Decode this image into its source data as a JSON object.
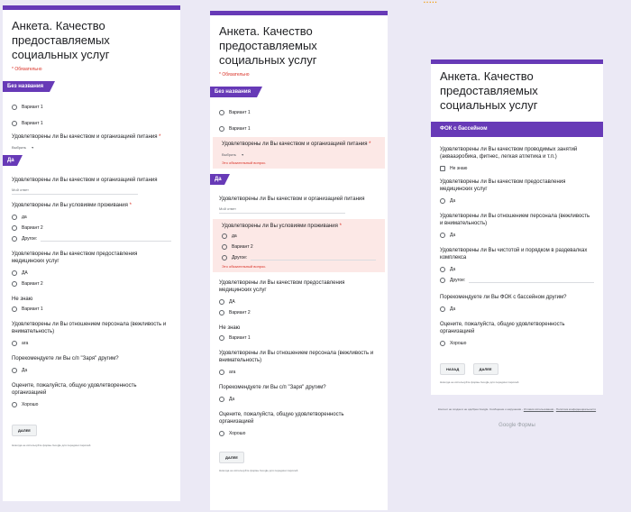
{
  "form_title": "Анкета. Качество предоставляемых социальных услуг",
  "required_label": "* Обязательно",
  "required_error": "Это обязательный вопрос.",
  "short_answer_placeholder": "Мой ответ",
  "next_button": "ДАЛЕЕ",
  "back_button": "НАЗАД",
  "footer_note": "Никогда не используйте формы Google для передачи паролей.",
  "google_note_1": "Контент не создан и не одобрен Google. Сообщение о нарушении -",
  "google_note_link1": "Условия использования",
  "google_note_link2": "Политика конфиденциальности",
  "google_forms_brand": "Google Формы",
  "top_icons": "▪ ▪ ▪ ▪ ▪",
  "panel1": {
    "section1": "Без названия",
    "section2": "Да",
    "opt_v1": "Вариант 1",
    "opt_v1b": "Вариант 1",
    "q_food": "Удовлетворены ли Вы качеством и организацией питания",
    "dropdown": "Выбрать",
    "q_food2": "Удовлетворены ли Вы качеством и организацией питания",
    "q_living": "Удовлетворены ли Вы условиями проживания",
    "opt_da": "да",
    "opt_v2": "Вариант 2",
    "opt_other": "Другое:",
    "q_medical": "Удовлетворены ли Вы качеством предоставления медицинских услуг",
    "opt_DA": "ДА",
    "opt_v2b": "Вариант 2",
    "q_dontknow": "Не знаю",
    "opt_v1c": "Вариант 1",
    "q_staff": "Удовлетворены ли Вы отношением персонала (вежливость и внимательность)",
    "opt_aga": "ага",
    "q_recommend": "Порекомендуете ли Вы с/п \"Заря\" другим?",
    "opt_da2": "Да",
    "q_rate": "Оцените, пожалуйста, общую удовлетворенность организацией",
    "opt_good": "Хорошо"
  },
  "panel2": {
    "section1": "Без названия",
    "section2": "Да",
    "opt_v1": "Вариант 1",
    "opt_v1b": "Вариант 1",
    "q_food": "Удовлетворены ли Вы качеством и организацией питания",
    "dropdown": "Выбрать",
    "q_food2": "Удовлетворены ли Вы качеством и организацией питания",
    "q_living": "Удовлетворены ли Вы условиями проживания",
    "opt_da": "да",
    "opt_v2": "Вариант 2",
    "opt_other": "Другое:",
    "q_medical": "Удовлетворены ли Вы качеством предоставления медицинских услуг",
    "opt_DA": "ДА",
    "opt_v2b": "Вариант 2",
    "q_dontknow": "Не знаю",
    "opt_v1c": "Вариант 1",
    "q_staff": "Удовлетворены ли Вы отношением персонала (вежливость и внимательность)",
    "opt_aga": "ага",
    "q_recommend": "Порекомендуете ли Вы с/п \"Заря\" другим?",
    "opt_da2": "Да",
    "q_rate": "Оцените, пожалуйста, общую удовлетворенность организацией",
    "opt_good": "Хорошо"
  },
  "panel3": {
    "section": "ФОК с бассейном",
    "q_classes": "Удовлетворены ли Вы качеством проводимых занятий (аквааэробика, фитнес, легкая атлетика и т.п.)",
    "opt_dontknow": "Не знаю",
    "q_medical": "Удовлетворены ли Вы качеством предоставления медицинских услуг",
    "opt_da1": "Да",
    "q_staff": "Удовлетворены ли Вы отношением персонала (вежливость и внимательность)",
    "opt_da2": "Да",
    "q_clean": "Удовлетворены ли Вы чистотой и порядком в раздевалках комплекса",
    "opt_da3": "Да",
    "opt_other": "Другое:",
    "q_recommend": "Порекомендуете ли Вы ФОК с бассейном другим?",
    "opt_da4": "Да",
    "q_rate": "Оцените, пожалуйста, общую удовлетворенность организацией",
    "opt_good": "Хорошо"
  }
}
